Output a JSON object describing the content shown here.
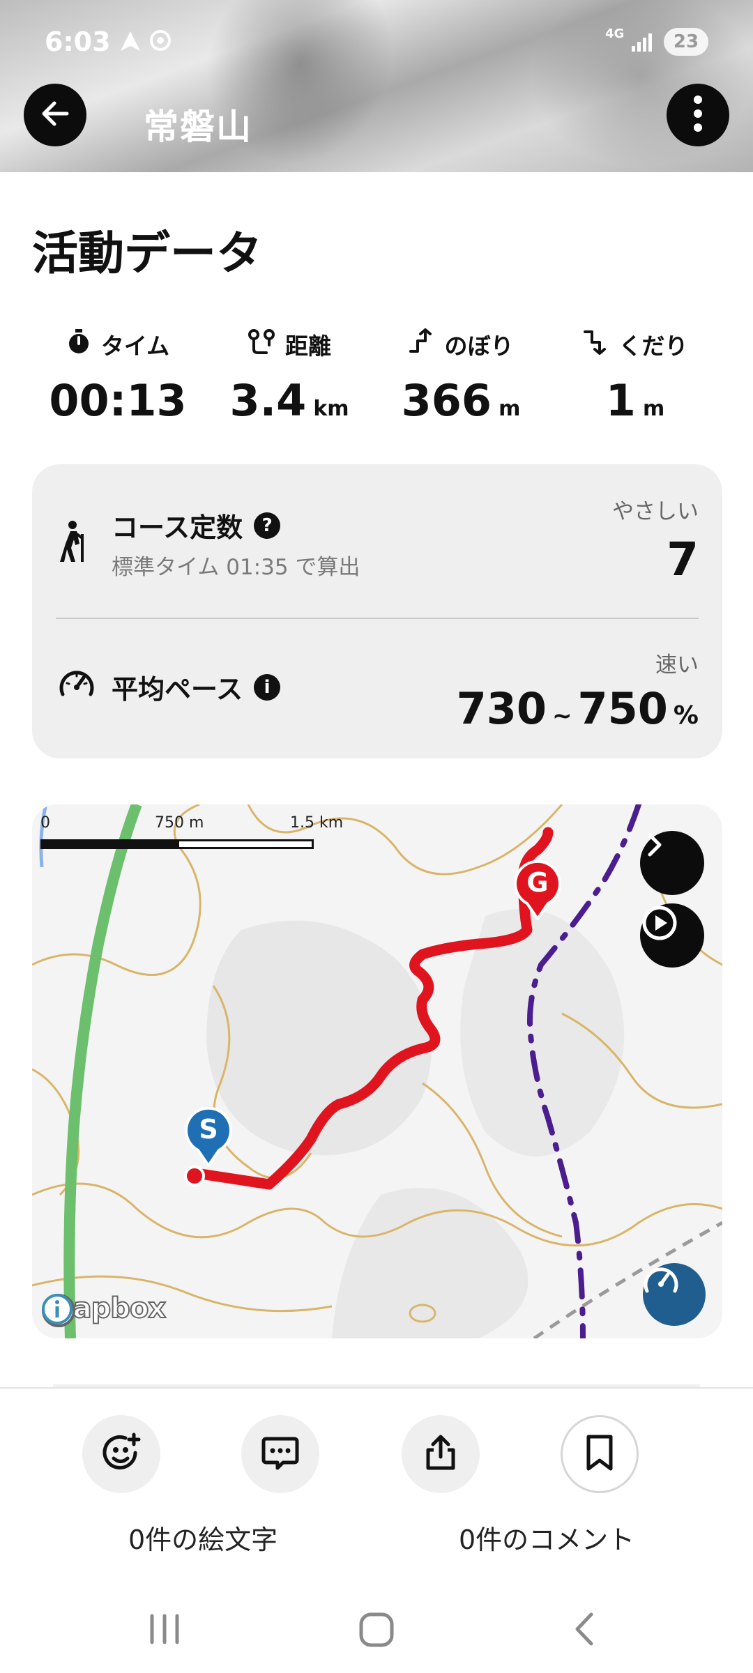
{
  "status_bar": {
    "time": "6:03",
    "network": "4G",
    "battery": "23"
  },
  "header": {
    "title": "常磐山",
    "back_icon": "arrow-left-icon",
    "menu_icon": "more-vertical-icon"
  },
  "section": {
    "title": "活動データ"
  },
  "stats": [
    {
      "label": "タイム",
      "value": "00:13",
      "unit": "",
      "icon": "stopwatch-icon"
    },
    {
      "label": "距離",
      "value": "3.4",
      "unit": "km",
      "icon": "route-icon"
    },
    {
      "label": "のぼり",
      "value": "366",
      "unit": "m",
      "icon": "ascent-icon"
    },
    {
      "label": "くだり",
      "value": "1",
      "unit": "m",
      "icon": "descent-icon"
    }
  ],
  "course_constant": {
    "title": "コース定数",
    "subtitle": "標準タイム 01:35 で算出",
    "rating": "やさしい",
    "value": "7",
    "help_glyph": "?"
  },
  "average_pace": {
    "title": "平均ペース",
    "info_glyph": "i",
    "rating": "速い",
    "range_low": "730",
    "range_sep": "~",
    "range_high": "750",
    "unit": "%"
  },
  "map": {
    "scale_labels": [
      "0",
      "750 m",
      "1.5 km"
    ],
    "start_marker": "S",
    "goal_marker": "G",
    "attribution": "mapbox",
    "colors": {
      "track": "#e0141e",
      "trail": "#4b1d8f",
      "road": "#6cbf6c",
      "contour": "#d9b56a"
    }
  },
  "actions": {
    "emoji_count": "0件の絵文字",
    "comment_count": "0件のコメント"
  }
}
